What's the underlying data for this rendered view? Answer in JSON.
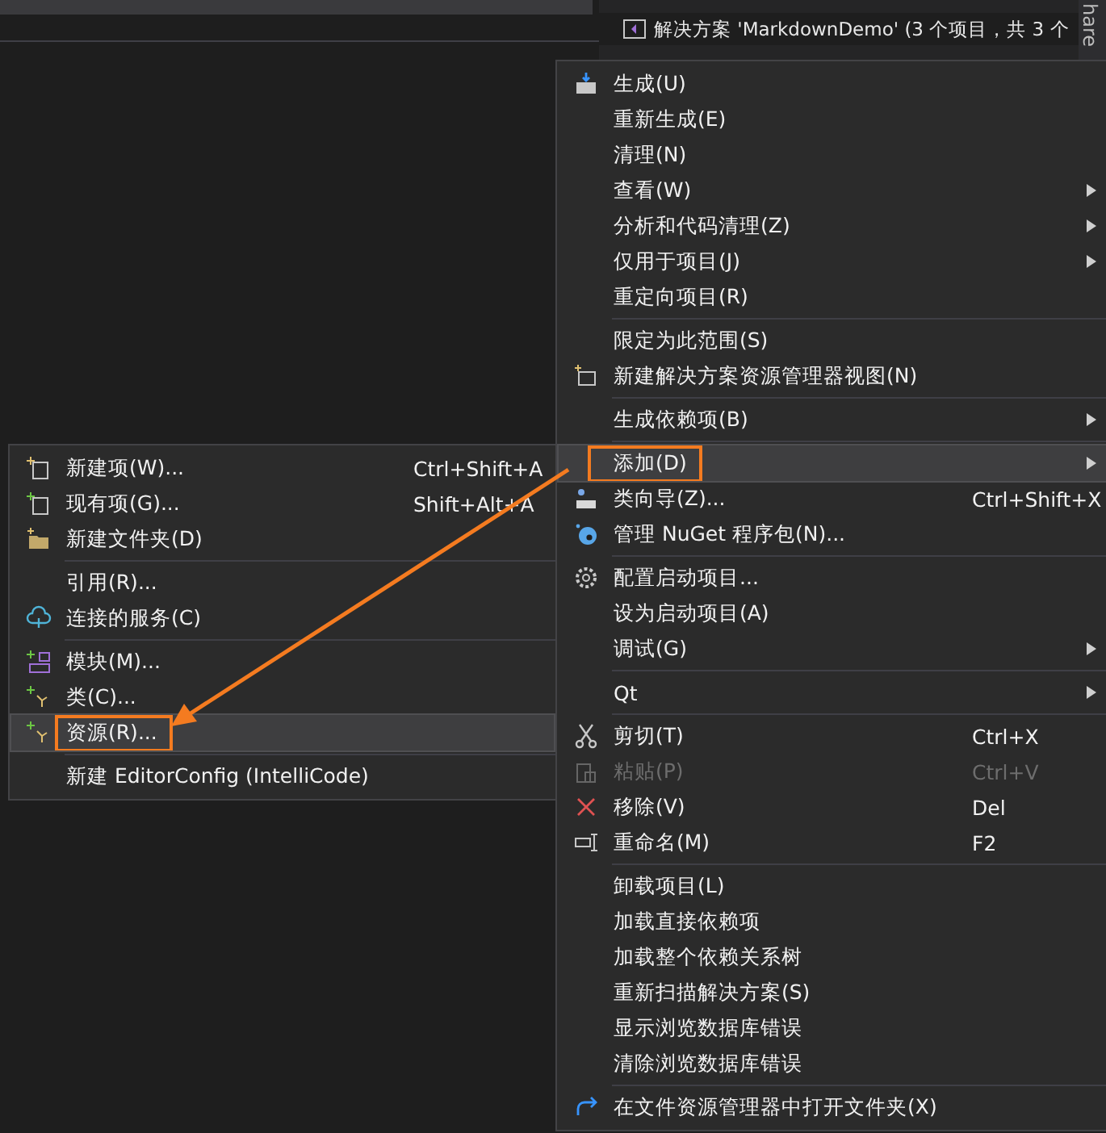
{
  "solution_explorer": {
    "rows": [
      {
        "label": "解决方案 'MarkdownDemo' (3 个项目，共 3 个"
      }
    ],
    "side_tab": "hare"
  },
  "context_menu": {
    "items": [
      {
        "kind": "item",
        "label": "生成(U)",
        "selected": false,
        "disabled": false,
        "has_submenu": false
      },
      {
        "kind": "item",
        "label": "重新生成(E)",
        "selected": false,
        "disabled": false,
        "has_submenu": false
      },
      {
        "kind": "item",
        "label": "清理(N)",
        "selected": false,
        "disabled": false,
        "has_submenu": false
      },
      {
        "kind": "item",
        "label": "查看(W)",
        "selected": false,
        "disabled": false,
        "has_submenu": true
      },
      {
        "kind": "item",
        "label": "分析和代码清理(Z)",
        "selected": false,
        "disabled": false,
        "has_submenu": true
      },
      {
        "kind": "item",
        "label": "仅用于项目(J)",
        "selected": false,
        "disabled": false,
        "has_submenu": true
      },
      {
        "kind": "item",
        "label": "重定向项目(R)",
        "selected": false,
        "disabled": false,
        "has_submenu": false
      },
      {
        "kind": "separator"
      },
      {
        "kind": "item",
        "label": "限定为此范围(S)",
        "selected": false,
        "disabled": false,
        "has_submenu": false
      },
      {
        "kind": "item",
        "label": "新建解决方案资源管理器视图(N)",
        "selected": false,
        "disabled": false,
        "has_submenu": false
      },
      {
        "kind": "separator"
      },
      {
        "kind": "item",
        "label": "生成依赖项(B)",
        "selected": false,
        "disabled": false,
        "has_submenu": true
      },
      {
        "kind": "separator"
      },
      {
        "kind": "item",
        "label": "添加(D)",
        "selected": true,
        "disabled": false,
        "has_submenu": true
      },
      {
        "kind": "item",
        "label": "类向导(Z)...",
        "shortcut": "Ctrl+Shift+X",
        "selected": false,
        "disabled": false,
        "has_submenu": false
      },
      {
        "kind": "item",
        "label": "管理 NuGet 程序包(N)...",
        "selected": false,
        "disabled": false,
        "has_submenu": false
      },
      {
        "kind": "separator"
      },
      {
        "kind": "item",
        "label": "配置启动项目...",
        "selected": false,
        "disabled": false,
        "has_submenu": false
      },
      {
        "kind": "item",
        "label": "设为启动项目(A)",
        "selected": false,
        "disabled": false,
        "has_submenu": false
      },
      {
        "kind": "item",
        "label": "调试(G)",
        "selected": false,
        "disabled": false,
        "has_submenu": true
      },
      {
        "kind": "separator"
      },
      {
        "kind": "item",
        "label": "Qt",
        "selected": false,
        "disabled": false,
        "has_submenu": true
      },
      {
        "kind": "separator"
      },
      {
        "kind": "item",
        "label": "剪切(T)",
        "shortcut": "Ctrl+X",
        "selected": false,
        "disabled": false,
        "has_submenu": false
      },
      {
        "kind": "item",
        "label": "粘贴(P)",
        "shortcut": "Ctrl+V",
        "selected": false,
        "disabled": true,
        "has_submenu": false
      },
      {
        "kind": "item",
        "label": "移除(V)",
        "shortcut": "Del",
        "selected": false,
        "disabled": false,
        "has_submenu": false
      },
      {
        "kind": "item",
        "label": "重命名(M)",
        "shortcut": "F2",
        "selected": false,
        "disabled": false,
        "has_submenu": false
      },
      {
        "kind": "separator"
      },
      {
        "kind": "item",
        "label": "卸载项目(L)",
        "selected": false,
        "disabled": false,
        "has_submenu": false
      },
      {
        "kind": "item",
        "label": "加载直接依赖项",
        "selected": false,
        "disabled": false,
        "has_submenu": false
      },
      {
        "kind": "item",
        "label": "加载整个依赖关系树",
        "selected": false,
        "disabled": false,
        "has_submenu": false
      },
      {
        "kind": "item",
        "label": "重新扫描解决方案(S)",
        "selected": false,
        "disabled": false,
        "has_submenu": false
      },
      {
        "kind": "item",
        "label": "显示浏览数据库错误",
        "selected": false,
        "disabled": false,
        "has_submenu": false
      },
      {
        "kind": "item",
        "label": "清除浏览数据库错误",
        "selected": false,
        "disabled": false,
        "has_submenu": false
      },
      {
        "kind": "separator"
      },
      {
        "kind": "item",
        "label": "在文件资源管理器中打开文件夹(X)",
        "selected": false,
        "disabled": false,
        "has_submenu": false
      }
    ]
  },
  "add_submenu": {
    "items": [
      {
        "kind": "item",
        "label": "新建项(W)...",
        "shortcut": "Ctrl+Shift+A",
        "selected": false
      },
      {
        "kind": "item",
        "label": "现有项(G)...",
        "shortcut": "Shift+Alt+A",
        "selected": false
      },
      {
        "kind": "item",
        "label": "新建文件夹(D)",
        "selected": false
      },
      {
        "kind": "separator"
      },
      {
        "kind": "item",
        "label": "引用(R)...",
        "selected": false
      },
      {
        "kind": "item",
        "label": "连接的服务(C)",
        "selected": false
      },
      {
        "kind": "separator"
      },
      {
        "kind": "item",
        "label": "模块(M)...",
        "selected": false
      },
      {
        "kind": "item",
        "label": "类(C)...",
        "selected": false
      },
      {
        "kind": "item",
        "label": "资源(R)...",
        "selected": true
      },
      {
        "kind": "separator"
      },
      {
        "kind": "item",
        "label": "新建 EditorConfig (IntelliCode)",
        "selected": false
      }
    ]
  }
}
